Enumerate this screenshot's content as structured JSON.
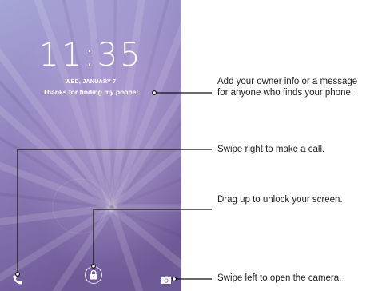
{
  "lockscreen": {
    "time": "11:35",
    "date": "WED, JANUARY 7",
    "owner_message": "Thanks for finding my phone!"
  },
  "icons": {
    "phone": "phone-icon",
    "lock": "lock-icon",
    "camera": "camera-icon"
  },
  "callouts": [
    {
      "text": "Add your owner info or a message for anyone who finds your phone."
    },
    {
      "text": "Swipe right to make a call."
    },
    {
      "text": "Drag up to unlock your screen."
    },
    {
      "text": "Swipe left to open the camera."
    }
  ],
  "colors": {
    "wallpaper_top": "#8a9bd4",
    "wallpaper_bottom": "#7a5f9e",
    "callout_line": "#111111"
  }
}
